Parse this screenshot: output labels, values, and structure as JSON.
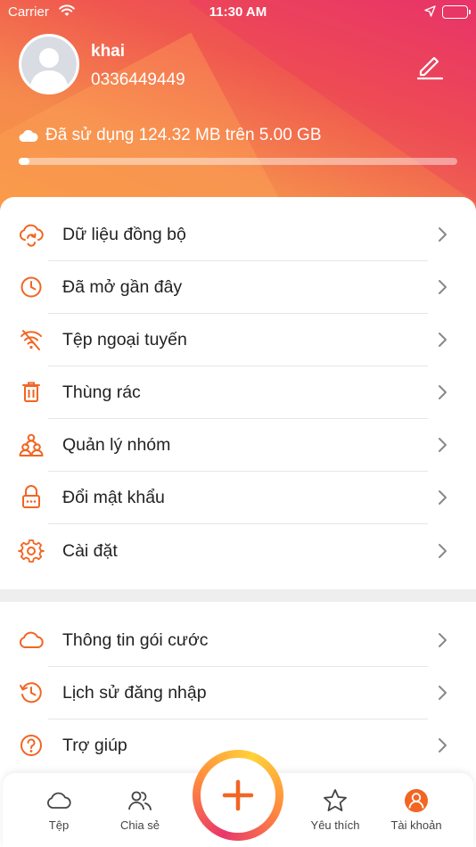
{
  "status_bar": {
    "carrier": "Carrier",
    "time": "11:30 AM"
  },
  "profile": {
    "name": "khai",
    "phone": "0336449449"
  },
  "storage": {
    "text": "Đã sử dụng 124.32 MB trên 5.00 GB",
    "used_fraction": 0.025
  },
  "menu_main": [
    {
      "label": "Dữ liệu đồng bộ",
      "icon": "cloud-sync-icon"
    },
    {
      "label": "Đã mở gần đây",
      "icon": "clock-icon"
    },
    {
      "label": "Tệp ngoại tuyến",
      "icon": "wifi-off-icon"
    },
    {
      "label": "Thùng rác",
      "icon": "trash-icon"
    },
    {
      "label": "Quản lý nhóm",
      "icon": "group-icon"
    },
    {
      "label": "Đổi mật khẩu",
      "icon": "password-icon"
    },
    {
      "label": "Cài đặt",
      "icon": "gear-icon"
    }
  ],
  "menu_secondary": [
    {
      "label": "Thông tin gói cước",
      "icon": "cloud-icon"
    },
    {
      "label": "Lịch sử đăng nhập",
      "icon": "history-icon"
    },
    {
      "label": "Trợ giúp",
      "icon": "help-icon"
    }
  ],
  "tabbar": {
    "files": "Tệp",
    "share": "Chia sẻ",
    "favorites": "Yêu thích",
    "account": "Tài khoản"
  },
  "colors": {
    "accent": "#f26522",
    "header_top": "#e8376b",
    "header_bottom": "#f7963e"
  }
}
